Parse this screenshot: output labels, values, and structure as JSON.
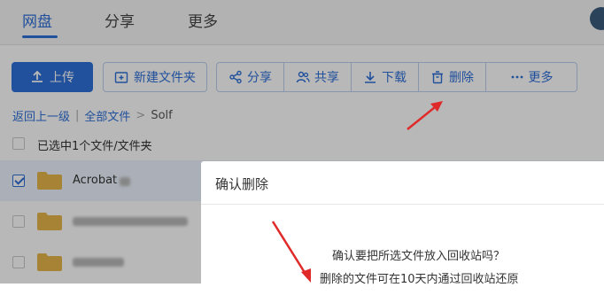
{
  "nav": {
    "tabs": [
      {
        "label": "网盘",
        "active": true
      },
      {
        "label": "分享",
        "active": false
      },
      {
        "label": "更多",
        "active": false
      }
    ]
  },
  "toolbar": {
    "upload_label": "上传",
    "new_folder_label": "新建文件夹",
    "share_label": "分享",
    "collab_label": "共享",
    "download_label": "下载",
    "delete_label": "删除",
    "more_label": "更多"
  },
  "breadcrumb": {
    "back_label": "返回上一级",
    "all_files_label": "全部文件",
    "current_label": "Solf"
  },
  "file_list": {
    "selection_text": "已选中1个文件/文件夹",
    "rows": [
      {
        "name": "Acrobat",
        "selected": true
      }
    ]
  },
  "dialog": {
    "title": "确认删除",
    "message_line1": "确认要把所选文件放入回收站吗？",
    "message_line2": "删除的文件可在10天内通过回收站还原"
  },
  "colors": {
    "accent": "#2e6fd8",
    "folder": "#e8b84a",
    "annotation_arrow": "#e02a2a"
  }
}
